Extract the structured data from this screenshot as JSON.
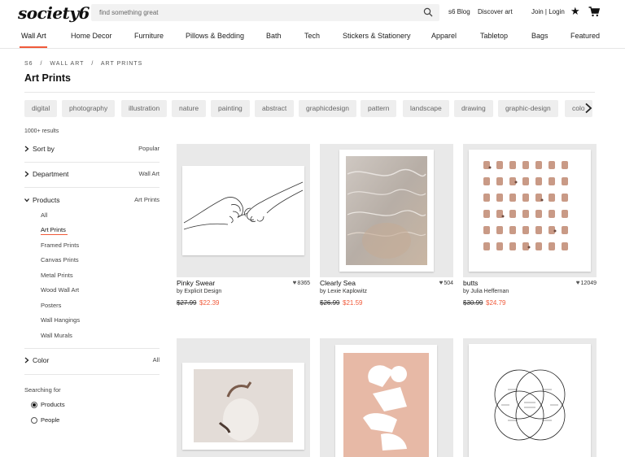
{
  "header": {
    "logo": "society6",
    "search_placeholder": "find something great",
    "links": [
      "s6 Blog",
      "Discover art",
      "Join | Login"
    ]
  },
  "categories": [
    "Wall Art",
    "Home Decor",
    "Furniture",
    "Pillows & Bedding",
    "Bath",
    "Tech",
    "Stickers & Stationery",
    "Apparel",
    "Tabletop",
    "Bags",
    "Featured"
  ],
  "breadcrumb": [
    "S6",
    "/",
    "Wall Art",
    "/",
    "Art Prints"
  ],
  "page_title": "Art Prints",
  "tags": [
    "digital",
    "photography",
    "illustration",
    "nature",
    "painting",
    "abstract",
    "graphicdesign",
    "pattern",
    "landscape",
    "drawing",
    "graphic-design",
    "colo"
  ],
  "results_count": "1000+ results",
  "facets": {
    "sort": {
      "label": "Sort by",
      "value": "Popular"
    },
    "department": {
      "label": "Department",
      "value": "Wall Art"
    },
    "products": {
      "label": "Products",
      "value": "Art Prints"
    },
    "color": {
      "label": "Color",
      "value": "All"
    }
  },
  "product_types": [
    "All",
    "Art Prints",
    "Framed Prints",
    "Canvas Prints",
    "Metal Prints",
    "Wood Wall Art",
    "Posters",
    "Wall Hangings",
    "Wall Murals"
  ],
  "searching_for": {
    "label": "Searching for",
    "options": [
      "Products",
      "People"
    ],
    "selected": "Products"
  },
  "products": [
    {
      "name": "Pinky Swear",
      "artist": "by Explicit Design",
      "favorites": "8365",
      "old_price": "$27.99",
      "price": "$22.39"
    },
    {
      "name": "Clearly Sea",
      "artist": "by Lexie Kaplowitz",
      "favorites": "504",
      "old_price": "$26.99",
      "price": "$21.59"
    },
    {
      "name": "butts",
      "artist": "by Julia Heffernan",
      "favorites": "12049",
      "old_price": "$30.99",
      "price": "$24.79"
    }
  ],
  "colors": {
    "accent": "#f05a3a",
    "chip_bg": "#eeeeee",
    "thumb_bg": "#e9e9e9"
  }
}
